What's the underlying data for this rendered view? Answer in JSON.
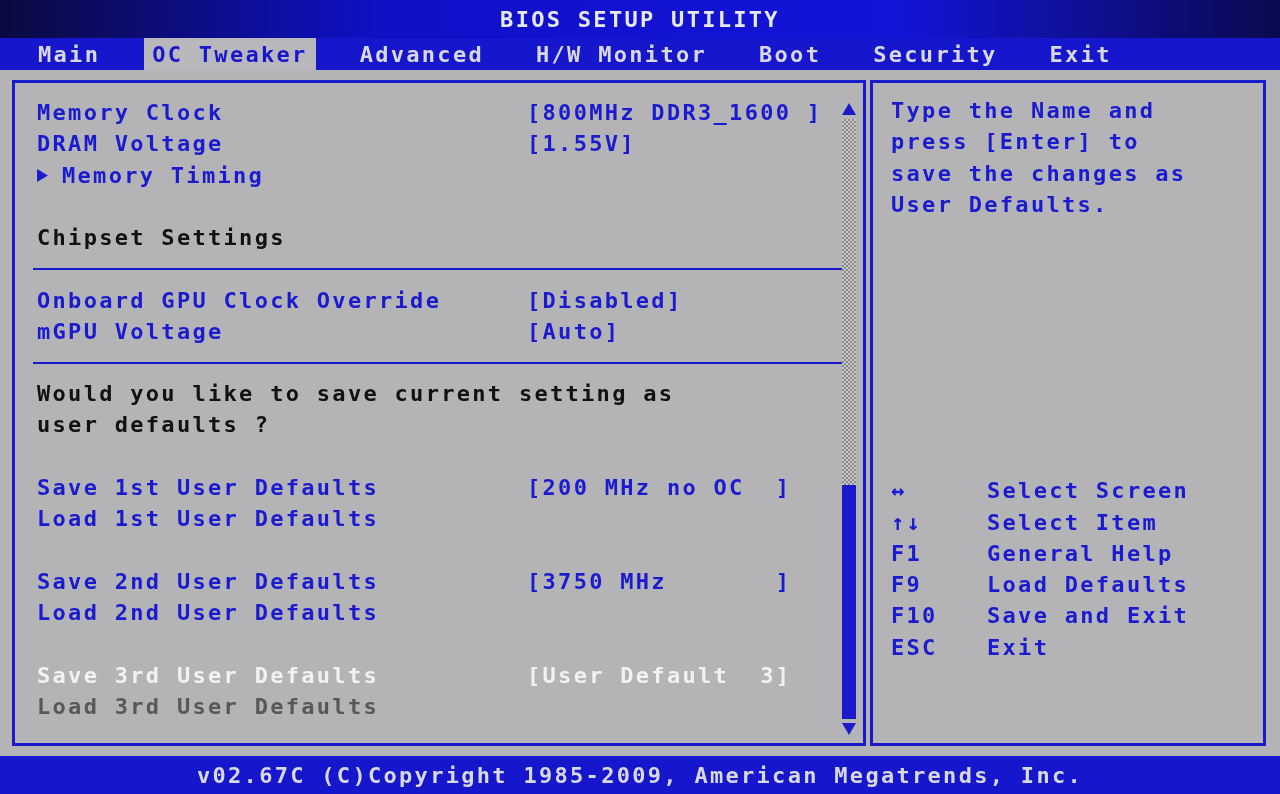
{
  "window": {
    "title": "BIOS SETUP UTILITY"
  },
  "tabs": [
    {
      "label": "Main",
      "selected": false
    },
    {
      "label": "OC Tweaker",
      "selected": true
    },
    {
      "label": "Advanced",
      "selected": false
    },
    {
      "label": "H/W Monitor",
      "selected": false
    },
    {
      "label": "Boot",
      "selected": false
    },
    {
      "label": "Security",
      "selected": false
    },
    {
      "label": "Exit",
      "selected": false
    }
  ],
  "settings": [
    {
      "kind": "setting",
      "label": "Memory Clock",
      "value": "[800MHz DDR3_1600 ]",
      "selected": false,
      "disabled": false
    },
    {
      "kind": "setting",
      "label": "DRAM Voltage",
      "value": "[1.55V]",
      "selected": false,
      "disabled": false
    },
    {
      "kind": "submenu",
      "label": "Memory Timing",
      "selected": false,
      "disabled": false
    },
    {
      "kind": "spacer"
    },
    {
      "kind": "heading",
      "label": "Chipset Settings"
    },
    {
      "kind": "divider"
    },
    {
      "kind": "setting",
      "label": "Onboard GPU Clock Override",
      "value": "[Disabled]",
      "selected": false,
      "disabled": false
    },
    {
      "kind": "setting",
      "label": "mGPU Voltage",
      "value": "[Auto]",
      "selected": false,
      "disabled": false
    },
    {
      "kind": "divider"
    },
    {
      "kind": "text",
      "label": "Would you like to save current setting as user defaults ?"
    },
    {
      "kind": "spacer"
    },
    {
      "kind": "setting",
      "label": "Save 1st User Defaults",
      "value": "[200 MHz no OC  ]",
      "selected": false,
      "disabled": false
    },
    {
      "kind": "setting",
      "label": "Load 1st User Defaults",
      "selected": false,
      "disabled": false
    },
    {
      "kind": "spacer"
    },
    {
      "kind": "setting",
      "label": "Save 2nd User Defaults",
      "value": "[3750 MHz       ]",
      "selected": false,
      "disabled": false
    },
    {
      "kind": "setting",
      "label": "Load 2nd User Defaults",
      "selected": false,
      "disabled": false
    },
    {
      "kind": "spacer"
    },
    {
      "kind": "setting",
      "label": "Save 3rd User Defaults",
      "value": "[User Default  3]",
      "selected": true,
      "disabled": false
    },
    {
      "kind": "setting",
      "label": "Load 3rd User Defaults",
      "selected": false,
      "disabled": true
    }
  ],
  "help_text": "Type the Name and press [Enter] to save the changes as User Defaults.",
  "keys": [
    {
      "key": "↔",
      "action": "Select Screen"
    },
    {
      "key": "↑↓",
      "action": "Select Item"
    },
    {
      "key": "F1",
      "action": "General Help"
    },
    {
      "key": "F9",
      "action": "Load Defaults"
    },
    {
      "key": "F10",
      "action": "Save and Exit"
    },
    {
      "key": "ESC",
      "action": "Exit"
    }
  ],
  "status_bar": "v02.67C (C)Copyright 1985-2009, American Megatrends, Inc."
}
